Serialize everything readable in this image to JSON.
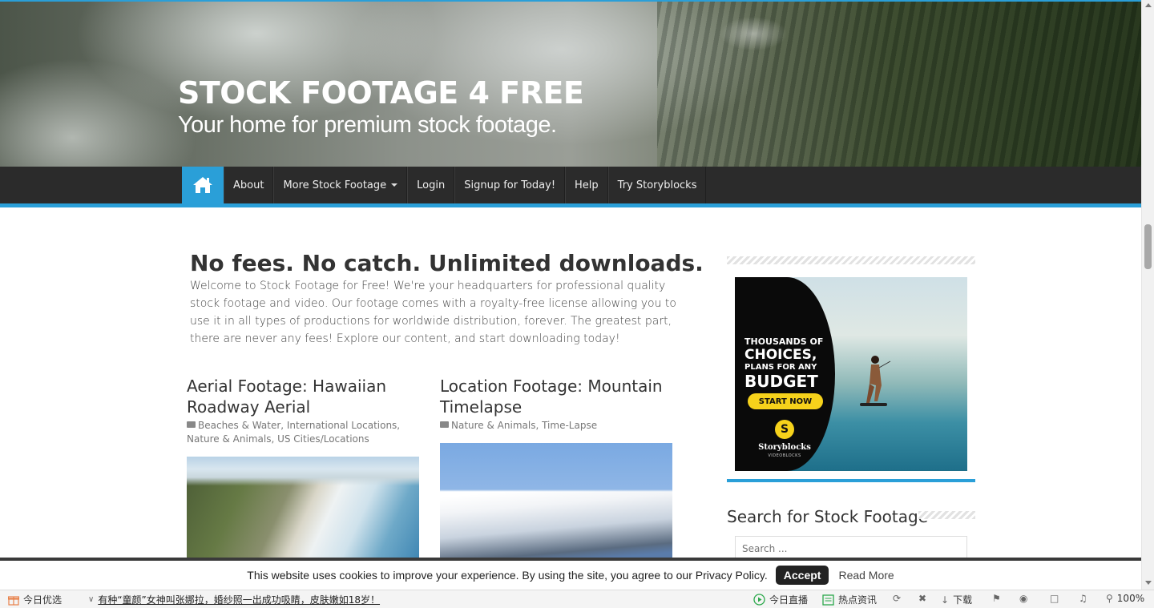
{
  "header": {
    "site_title": "STOCK FOOTAGE 4 FREE",
    "tagline": "Your home for premium stock footage."
  },
  "nav": {
    "home_icon": "home-icon",
    "items": [
      {
        "label": "About"
      },
      {
        "label": "More Stock Footage",
        "has_dropdown": true
      },
      {
        "label": "Login"
      },
      {
        "label": "Signup for Today!"
      },
      {
        "label": "Help"
      },
      {
        "label": "Try Storyblocks"
      }
    ]
  },
  "intro": {
    "title": "No fees. No catch. Unlimited downloads.",
    "text": "Welcome to Stock Footage for Free! We're your headquarters for professional quality stock footage and video. Our footage comes with a royalty-free license allowing you to use it in all types of productions for worldwide distribution, forever. The greatest part, there are never any fees! Explore our content, and start downloading today!"
  },
  "posts": [
    {
      "title": "Aerial Footage: Hawaiian Roadway Aerial",
      "categories": "Beaches & Water, International Locations, Nature & Animals, US Cities/Locations"
    },
    {
      "title": "Location Footage: Mountain Timelapse",
      "categories": "Nature & Animals, Time-Lapse"
    }
  ],
  "sidebar": {
    "ad": {
      "line1": "THOUSANDS OF",
      "line2": "CHOICES,",
      "line3": "PLANS FOR ANY",
      "line4": "BUDGET",
      "cta": "START NOW",
      "logo_letter": "S",
      "brand": "Storyblocks",
      "brand_sub": "VIDEOBLOCKS"
    },
    "search_title": "Search for Stock Footage",
    "search_placeholder": "Search ..."
  },
  "cookie": {
    "message": "This website uses cookies to improve your experience. By using the site, you agree to our Privacy Policy.",
    "accept": "Accept",
    "read_more": "Read More"
  },
  "statusbar": {
    "left_label": "今日优选",
    "news": "有种“童颜”女神叫张娜拉，婚纱照一出成功吸睛，皮肤嫩如18岁！",
    "live": "今日直播",
    "hot": "热点资讯",
    "download": "下载",
    "zoom": "100%"
  },
  "colors": {
    "accent": "#2a9fd8",
    "nav_bg": "#2b2b2b",
    "cta_yellow": "#f6d21b"
  }
}
